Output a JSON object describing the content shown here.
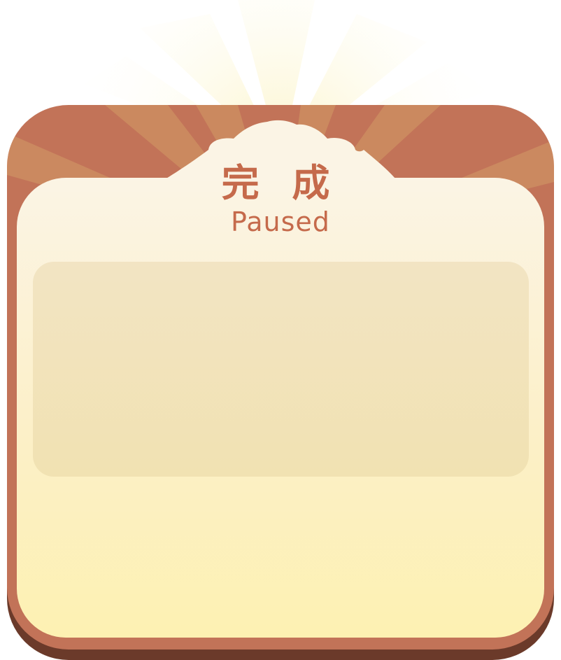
{
  "dialog": {
    "title_cn": "完 成",
    "title_en": "Paused"
  },
  "colors": {
    "frame": "#c27358",
    "frame_shadow": "#6b3a2a",
    "inner_top": "#fbf4e5",
    "inner_bottom": "#fdf1b2",
    "title": "#c56a4b",
    "panel": "#f2e4c3"
  }
}
